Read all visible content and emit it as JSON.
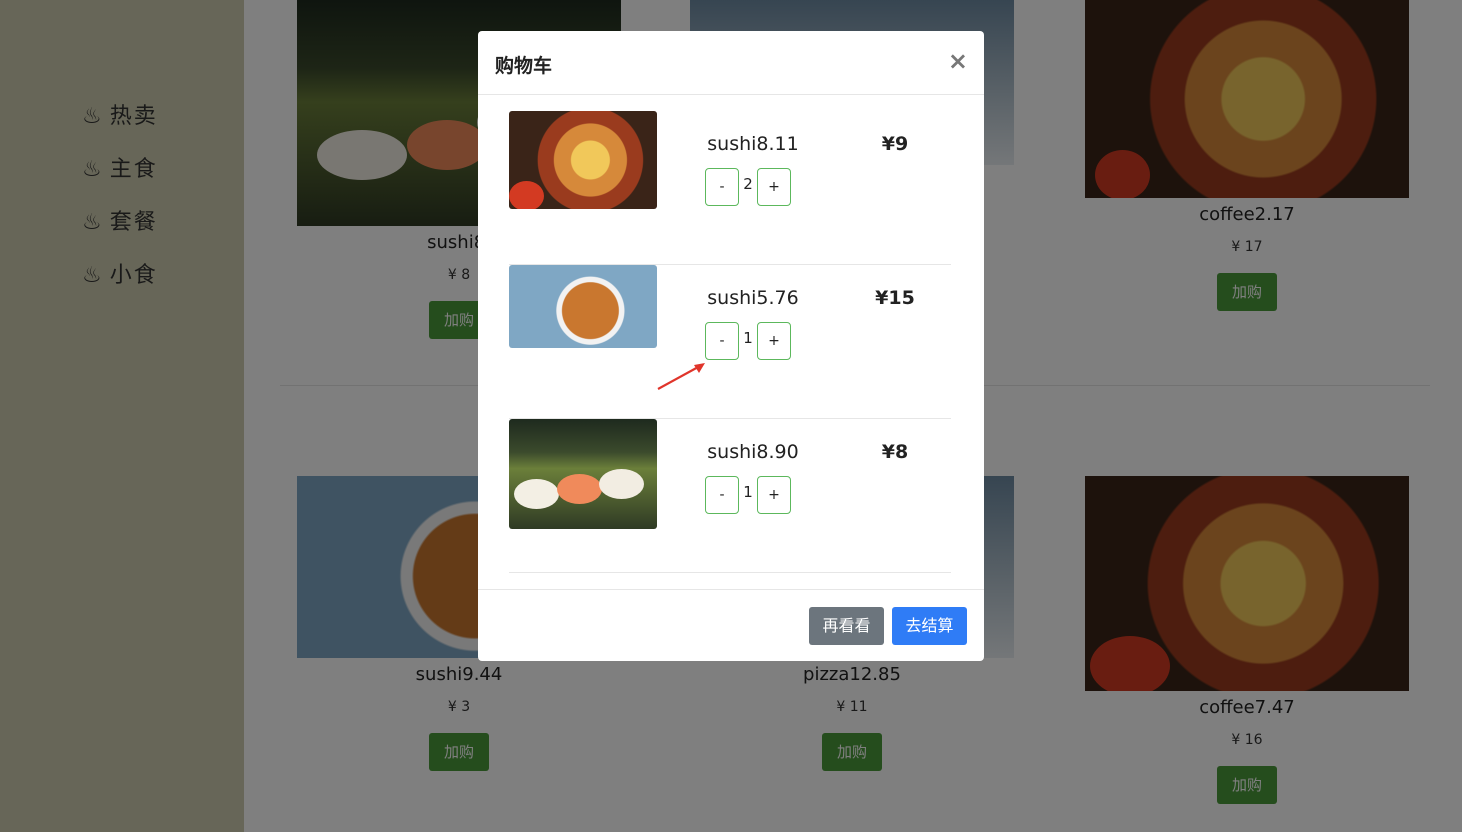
{
  "sidebar": {
    "items": [
      {
        "icon": "hot-steam-icon",
        "glyph": "♨",
        "label": "热卖"
      },
      {
        "icon": "hot-steam-icon",
        "glyph": "♨",
        "label": "主食"
      },
      {
        "icon": "hot-steam-icon",
        "glyph": "♨",
        "label": "套餐"
      },
      {
        "icon": "hot-steam-icon",
        "glyph": "♨",
        "label": "小食"
      }
    ]
  },
  "products": [
    {
      "name": "sushi8.",
      "price": "¥ 8",
      "buy_label": "加购"
    },
    {
      "name": "coffee2.17",
      "price": "¥ 17",
      "buy_label": "加购"
    },
    {
      "name": "sushi9.44",
      "price": "¥ 3",
      "buy_label": "加购"
    },
    {
      "name": "pizza12.85",
      "price": "¥ 11",
      "buy_label": "加购"
    },
    {
      "name": "coffee7.47",
      "price": "¥ 16",
      "buy_label": "加购"
    }
  ],
  "cart_modal": {
    "title": "购物车",
    "close_glyph": "×",
    "items": [
      {
        "name": "sushi8.11",
        "price": "¥9",
        "qty": "2",
        "minus": "-",
        "plus": "+"
      },
      {
        "name": "sushi5.76",
        "price": "¥15",
        "qty": "1",
        "minus": "-",
        "plus": "+"
      },
      {
        "name": "sushi8.90",
        "price": "¥8",
        "qty": "1",
        "minus": "-",
        "plus": "+"
      }
    ],
    "back_label": "再看看",
    "checkout_label": "去结算"
  },
  "colors": {
    "sidebar_bg": "#cfcdb0",
    "buy_button": "#4a9a3a",
    "checkout_button": "#2f7cf6",
    "back_button": "#6c757d",
    "stepper_border": "#5cb85c",
    "annotation_arrow": "#e0352b"
  }
}
